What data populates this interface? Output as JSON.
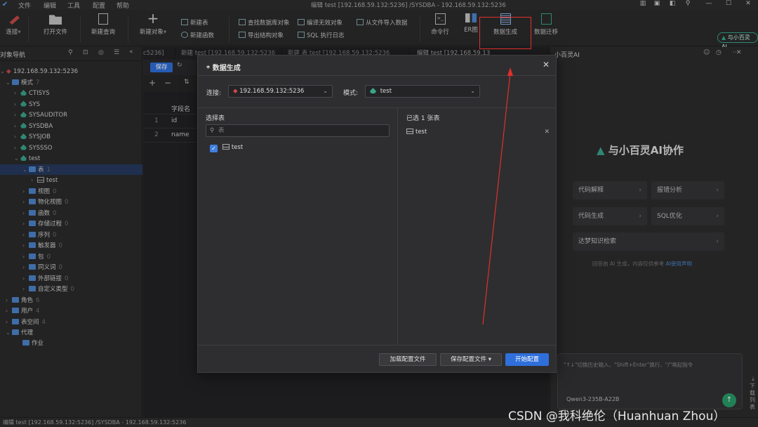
{
  "titlebar": {
    "menus": [
      "文件",
      "编辑",
      "工具",
      "配置",
      "帮助"
    ],
    "window_title": "编辑 test [192.168.59.132:5236] /SYSDBA - 192.168.59.132:5236"
  },
  "toolbar": {
    "connect": "连接",
    "open_file": "打开文件",
    "new_query": "新建查询",
    "new_object": "新建对象",
    "new_table": "新建表",
    "new_function": "新建函数",
    "find_db_object": "查找数据库对象",
    "export_structure": "导出结构对象",
    "compile_invalid": "编译无效对象",
    "sql_log": "SQL 执行日志",
    "import_from_file": "从文件导入数据",
    "cmdline": "命令行",
    "er": "ER图",
    "data_gen": "数据生成",
    "data_migrate": "数据迁移",
    "ai_badge": "与小百灵 AI"
  },
  "leftpanel": {
    "title": "对象导航",
    "connection": "192.168.59.132:5236",
    "schema_group": "模式",
    "schema_count": "7",
    "schemas": [
      "CTISYS",
      "SYS",
      "SYSAUDITOR",
      "SYSDBA",
      "SYSJOB",
      "SYSSSO",
      "test"
    ],
    "table_folder": "表",
    "table_count": "1",
    "table_item": "test",
    "folders": [
      {
        "label": "视图",
        "count": "0"
      },
      {
        "label": "物化视图",
        "count": "0"
      },
      {
        "label": "函数",
        "count": "0"
      },
      {
        "label": "存储过程",
        "count": "0"
      },
      {
        "label": "序列",
        "count": "0"
      },
      {
        "label": "触发器",
        "count": "0"
      },
      {
        "label": "包",
        "count": "0"
      },
      {
        "label": "同义词",
        "count": "0"
      },
      {
        "label": "外部链接",
        "count": "0"
      },
      {
        "label": "自定义类型",
        "count": "0"
      }
    ],
    "roles": "角色",
    "roles_count": "6",
    "users": "用户",
    "users_count": "4",
    "tablespaces": "表空间",
    "tablespaces_count": "4",
    "agent": "代理",
    "job": "作业"
  },
  "editor": {
    "tabs": [
      "c5236]",
      "新建 test [192.168.59.132:5236",
      "新建 表 test [192.168.59.132:5236",
      "编辑 test [192.168.59.13"
    ],
    "save": "保存",
    "column_header": "字段名",
    "rows": [
      {
        "n": "1",
        "name": "id"
      },
      {
        "n": "2",
        "name": "name"
      }
    ]
  },
  "aipanel": {
    "title": "小百灵AI",
    "headline": "与小百灵AI协作",
    "buttons": [
      "代码解释",
      "报错分析",
      "代码生成",
      "SQL优化",
      "达梦知识检索"
    ],
    "disclaimer": "回答由 AI 生成，内容仅供参考",
    "disclaimer_link": "AI使用声明",
    "input_placeholder": "\"↑↓\"切换历史输入、\"Shift+Enter\"换行、\"/\"唤起指令",
    "model": "Qwen3-235B-A22B",
    "side_label": "下载列表"
  },
  "dialog": {
    "title": "* 数据生成",
    "conn_label": "连接:",
    "conn_value": "192.168.59.132:5236",
    "schema_label": "模式:",
    "schema_value": "test",
    "choose_label": "选择表",
    "search_placeholder": "表",
    "table_name": "test",
    "selected_label": "已选 1 张表",
    "selected_table": "test",
    "btn_load": "加载配置文件",
    "btn_save": "保存配置文件",
    "btn_start": "开始配置"
  },
  "statusbar": {
    "text": "编辑 test [192.168.59.132:5236] /SYSDBA - 192.168.59.132:5236"
  },
  "watermark": "CSDN @我科绝伦（Huanhuan Zhou）",
  "colors": {
    "accent": "#2f6fdb",
    "highlight": "#e0302a",
    "folder": "#4d86cc",
    "db": "#3aa58a"
  }
}
